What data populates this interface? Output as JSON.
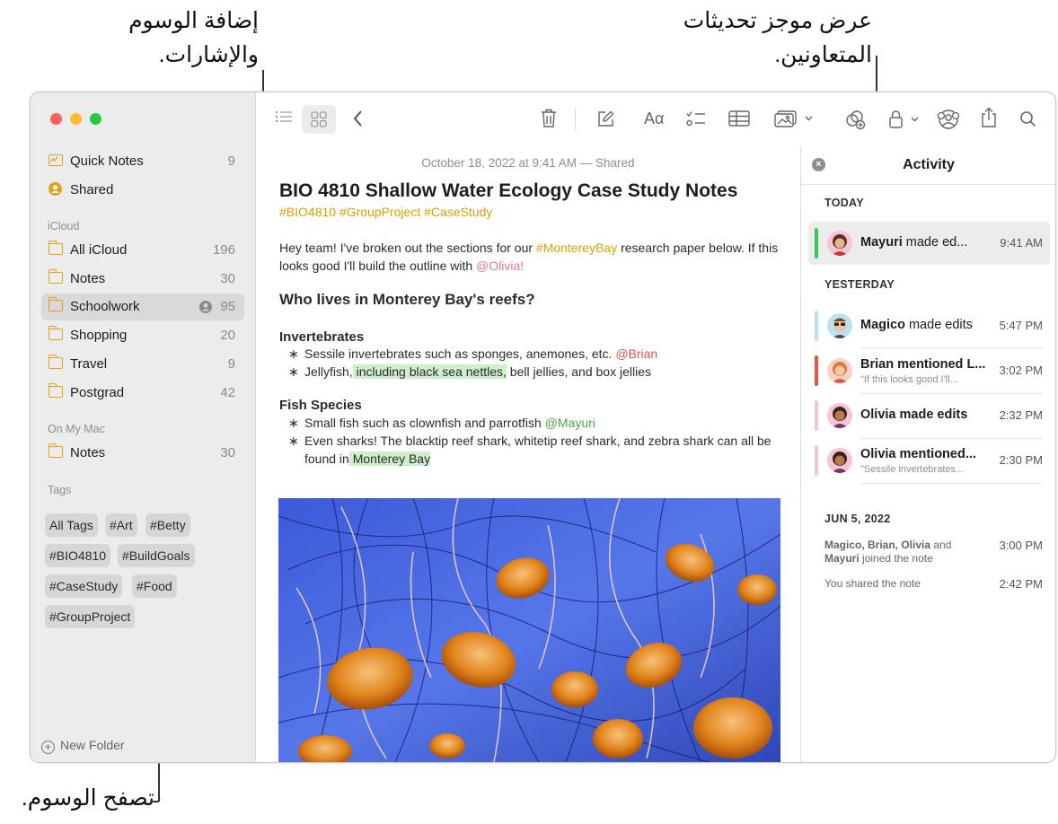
{
  "callouts": {
    "top_left": [
      "إضافة الوسوم",
      "والإشارات."
    ],
    "top_right": [
      "عرض موجز تحديثات",
      "المتعاونين."
    ],
    "bottom_left": "تصفح الوسوم."
  },
  "colors": {
    "accent": "#e3a11a",
    "tag_yellow": "#d9a100",
    "mention_pink": "#e7789c",
    "mention_red": "#e25548",
    "mention_green": "#49a94b",
    "highlight_green": "#cfeecb"
  },
  "sidebar": {
    "pinned": [
      {
        "label": "Quick Notes",
        "count": "9",
        "icon": "quick-notes-icon"
      },
      {
        "label": "Shared",
        "count": "",
        "icon": "shared-icon"
      }
    ],
    "icloud_header": "iCloud",
    "icloud": [
      {
        "label": "All iCloud",
        "count": "196"
      },
      {
        "label": "Notes",
        "count": "30"
      },
      {
        "label": "Schoolwork",
        "count": "95"
      },
      {
        "label": "Shopping",
        "count": "20"
      },
      {
        "label": "Travel",
        "count": "9"
      },
      {
        "label": "Postgrad",
        "count": "42"
      }
    ],
    "onmymac_header": "On My Mac",
    "onmymac": [
      {
        "label": "Notes",
        "count": "30"
      }
    ],
    "tags_header": "Tags",
    "tags": [
      "All Tags",
      "#Art",
      "#Betty",
      "#BIO4810",
      "#BuildGoals",
      "#CaseStudy",
      "#Food",
      "#GroupProject"
    ],
    "new_folder": "New Folder"
  },
  "note": {
    "date": "October 18, 2022 at 9:41 AM — Shared",
    "title": "BIO 4810 Shallow Water Ecology Case Study Notes",
    "tags": "#BIO4810 #GroupProject #CaseStudy",
    "para": {
      "p1": "Hey team! I've broken out the sections for our ",
      "tag": "#MontereyBay",
      "p2": " research paper below. If this looks good I'll build the outline with ",
      "mention": "@Olivia!"
    },
    "heading": "Who lives in Monterey Bay's reefs?",
    "invert_heading": "Invertebrates",
    "invert": {
      "b1_text": "Sessile invertebrates such as sponges, anemones, etc. ",
      "b1_mention": "@Brian",
      "b2_a": "Jellyfish,",
      "b2_highlight": " including black sea nettles,",
      "b2_b": " bell jellies, and box jellies"
    },
    "fish_heading": "Fish Species",
    "fish": {
      "b1_text": "Small fish such as clownfish and parrotfish ",
      "b1_mention": "@Mayuri",
      "b2_text": "Even sharks! The blacktip reef shark, whitetip reef shark, and zebra shark can all be found in",
      "b2_highlight": " Monterey Bay"
    },
    "bullet": "∗"
  },
  "activity": {
    "title": "Activity",
    "today_label": "TODAY",
    "yesterday_label": "YESTERDAY",
    "jun_label": "JUN 5, 2022",
    "today": [
      {
        "name": "Mayuri",
        "action": " made ed...",
        "time": "9:41 AM",
        "color": "#34c759"
      }
    ],
    "yesterday": [
      {
        "name": "Magico",
        "action": " made edits",
        "sub": "",
        "time": "5:47 PM",
        "color": "#b9e3f5"
      },
      {
        "name": "Brian",
        "action": " mentioned L...",
        "sub": "\"If this looks good I'll...",
        "time": "3:02 PM",
        "color": "#e25548"
      },
      {
        "name": "Olivia",
        "action": " made edits",
        "sub": "",
        "time": "2:32 PM",
        "color": "#f7c3d6"
      },
      {
        "name": "Olivia",
        "action": " mentioned...",
        "sub": "\"Sessile invertebrates...",
        "time": "2:30 PM",
        "color": "#f7c3d6"
      }
    ],
    "jun": {
      "joined_names": "Magico, Brian, Olivia",
      "joined_and": " and",
      "joined_name2": "Mayuri",
      "joined_rest": " joined the note",
      "joined_time": "3:00 PM",
      "shared": "You shared the note",
      "shared_time": "2:42 PM"
    }
  },
  "toolbar": {
    "font_label": "Aα"
  }
}
